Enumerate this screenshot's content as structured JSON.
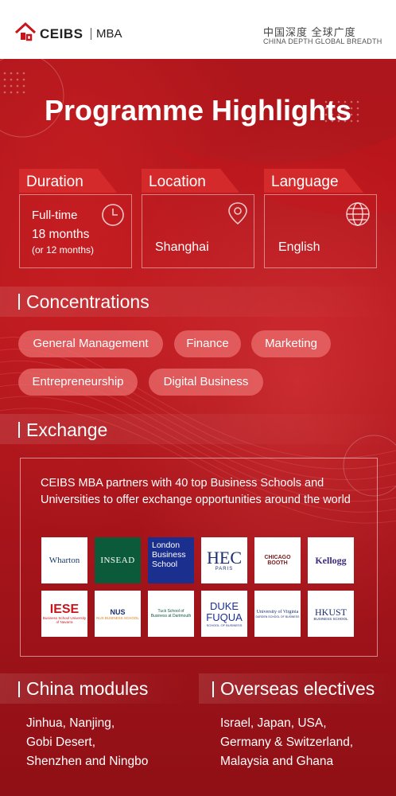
{
  "header": {
    "brand": "CEIBS",
    "program": "MBA",
    "tagline_cn": "中国深度 全球广度",
    "tagline_en": "CHINA DEPTH   GLOBAL BREADTH"
  },
  "title": "Programme Highlights",
  "highlights": [
    {
      "tab": "Duration",
      "line1": "Full-time",
      "line2": "18 months",
      "line3": "(or 12 months)",
      "icon": "clock-icon"
    },
    {
      "tab": "Location",
      "value": "Shanghai",
      "icon": "map-pin-icon"
    },
    {
      "tab": "Language",
      "value": "English",
      "icon": "globe-icon"
    }
  ],
  "concentrations": {
    "heading": "Concentrations",
    "items": [
      "General Management",
      "Finance",
      "Marketing",
      "Entrepreneurship",
      "Digital Business"
    ]
  },
  "exchange": {
    "heading": "Exchange",
    "description": "CEIBS MBA partners with 40 top Business Schools and Universities to offer exchange opportunities around the world",
    "logos": [
      {
        "name": "Wharton"
      },
      {
        "name": "INSEAD"
      },
      {
        "name": "London Business School"
      },
      {
        "name": "HEC",
        "sub": "PARIS"
      },
      {
        "name": "CHICAGO BOOTH"
      },
      {
        "name": "Kellogg"
      },
      {
        "name": "IESE",
        "sub": "Business School University of Navarra"
      },
      {
        "name": "NUS",
        "sub": "NUS BUSINESS SCHOOL"
      },
      {
        "name": "Tuck School of Business at Dartmouth"
      },
      {
        "name": "DUKE",
        "name2": "FUQUA",
        "sub": "SCHOOL OF BUSINESS"
      },
      {
        "name": "University of Virginia",
        "sub": "DARDEN SCHOOL OF BUSINESS"
      },
      {
        "name": "HKUST",
        "sub": "BUSINESS SCHOOL"
      }
    ]
  },
  "china_modules": {
    "heading": "China modules",
    "text": "Jinhua, Nanjing,\nGobi Desert,\nShenzhen and Ningbo"
  },
  "overseas": {
    "heading": "Overseas electives",
    "text": "Israel, Japan, USA,\nGermany & Switzerland,\nMalaysia and Ghana"
  },
  "colors": {
    "background": "#b8191f",
    "tab": "#d42a2c",
    "pill": "#e86b6b",
    "header_bg": "#ffffff"
  }
}
